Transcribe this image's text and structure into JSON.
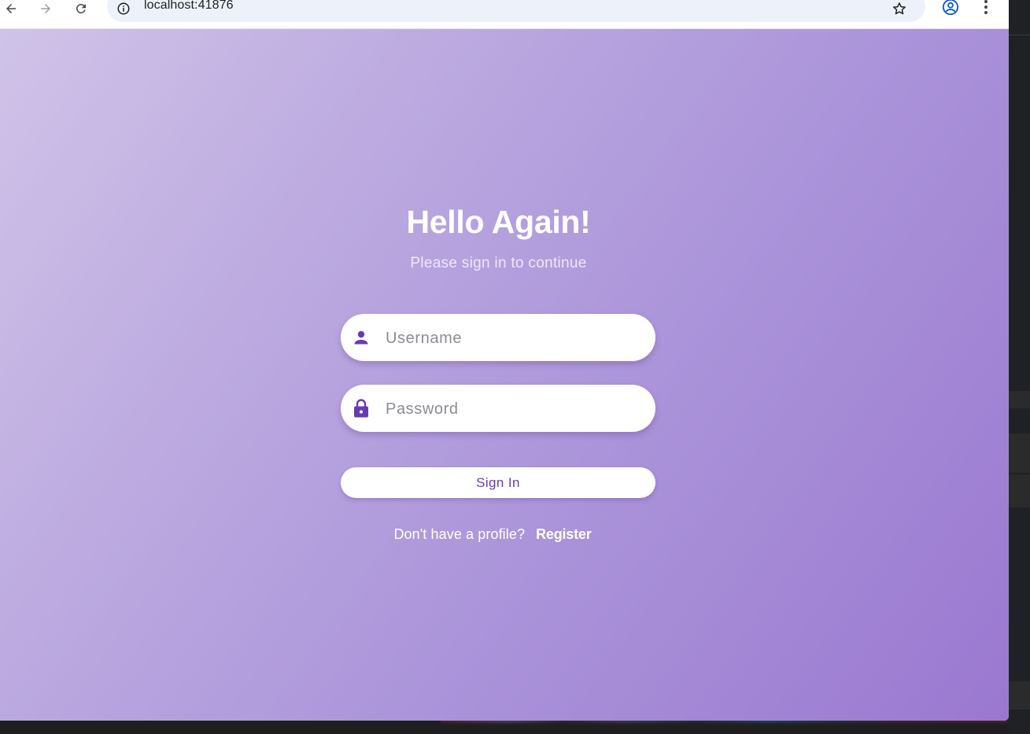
{
  "browser": {
    "url": "localhost:41876",
    "icons": {
      "back": "arrow-left-icon",
      "forward": "arrow-right-icon",
      "reload": "reload-icon",
      "site_info": "info-icon",
      "bookmark": "star-icon",
      "profile": "account-circle-icon",
      "menu": "more-vert-icon"
    }
  },
  "login": {
    "title": "Hello Again!",
    "subtitle": "Please sign in to continue",
    "username": {
      "placeholder": "Username",
      "value": "",
      "icon": "person-icon"
    },
    "password": {
      "placeholder": "Password",
      "value": "",
      "icon": "lock-icon"
    },
    "sign_in_label": "Sign In",
    "register_prompt": "Don't have a profile?",
    "register_link": "Register"
  },
  "colors": {
    "accent": "#673ab7",
    "gradient_start": "#d0c3e8",
    "gradient_end": "#9a78d0",
    "button_text": "#6a3bb4"
  }
}
